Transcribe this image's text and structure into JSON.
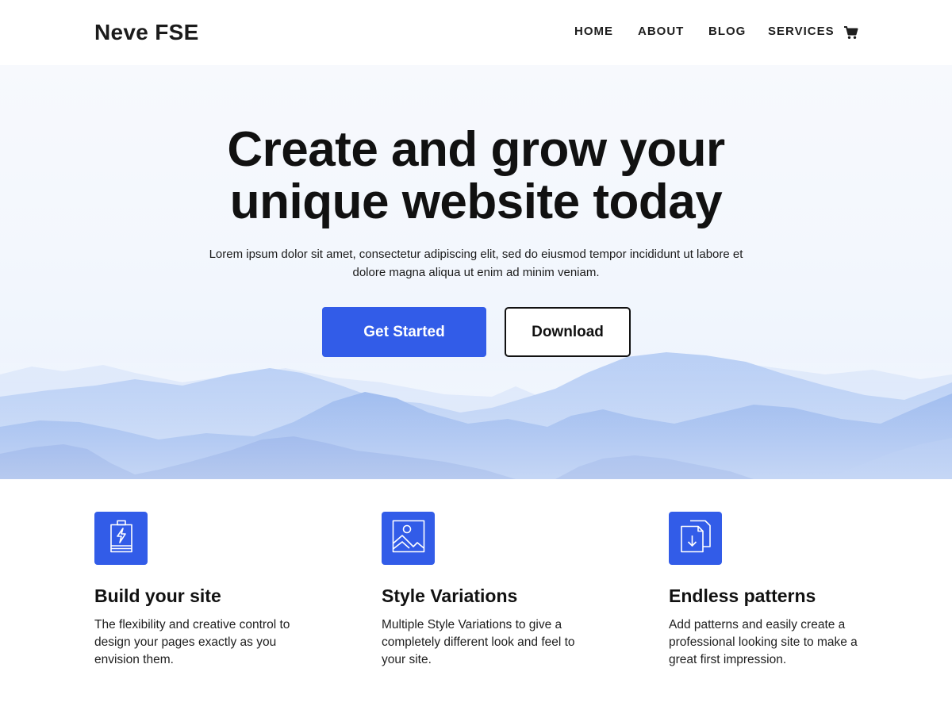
{
  "header": {
    "site_title": "Neve FSE",
    "nav": [
      {
        "label": "HOME"
      },
      {
        "label": "ABOUT"
      },
      {
        "label": "BLOG"
      },
      {
        "label": "SERVICES"
      }
    ],
    "cart_icon": "shopping-cart-icon"
  },
  "hero": {
    "title_line1": "Create and grow your",
    "title_line2": "unique website today",
    "description": "Lorem ipsum dolor sit amet, consectetur adipiscing elit, sed do eiusmod tempor incididunt ut labore et dolore magna aliqua ut enim ad minim veniam.",
    "primary_button": "Get Started",
    "secondary_button": "Download"
  },
  "features": [
    {
      "icon": "battery-charging-icon",
      "title": "Build your site",
      "text": "The flexibility and creative control to design your pages exactly as you envision them."
    },
    {
      "icon": "image-icon",
      "title": "Style Variations",
      "text": "Multiple Style Variations to give a completely different look and feel to your site."
    },
    {
      "icon": "documents-download-icon",
      "title": "Endless patterns",
      "text": "Add patterns and easily create a professional looking site to make a great first impression."
    }
  ],
  "colors": {
    "accent": "#325ce8",
    "text": "#111111",
    "hero_background": "#f3f7fd",
    "mountains": "#7aa2ea"
  }
}
